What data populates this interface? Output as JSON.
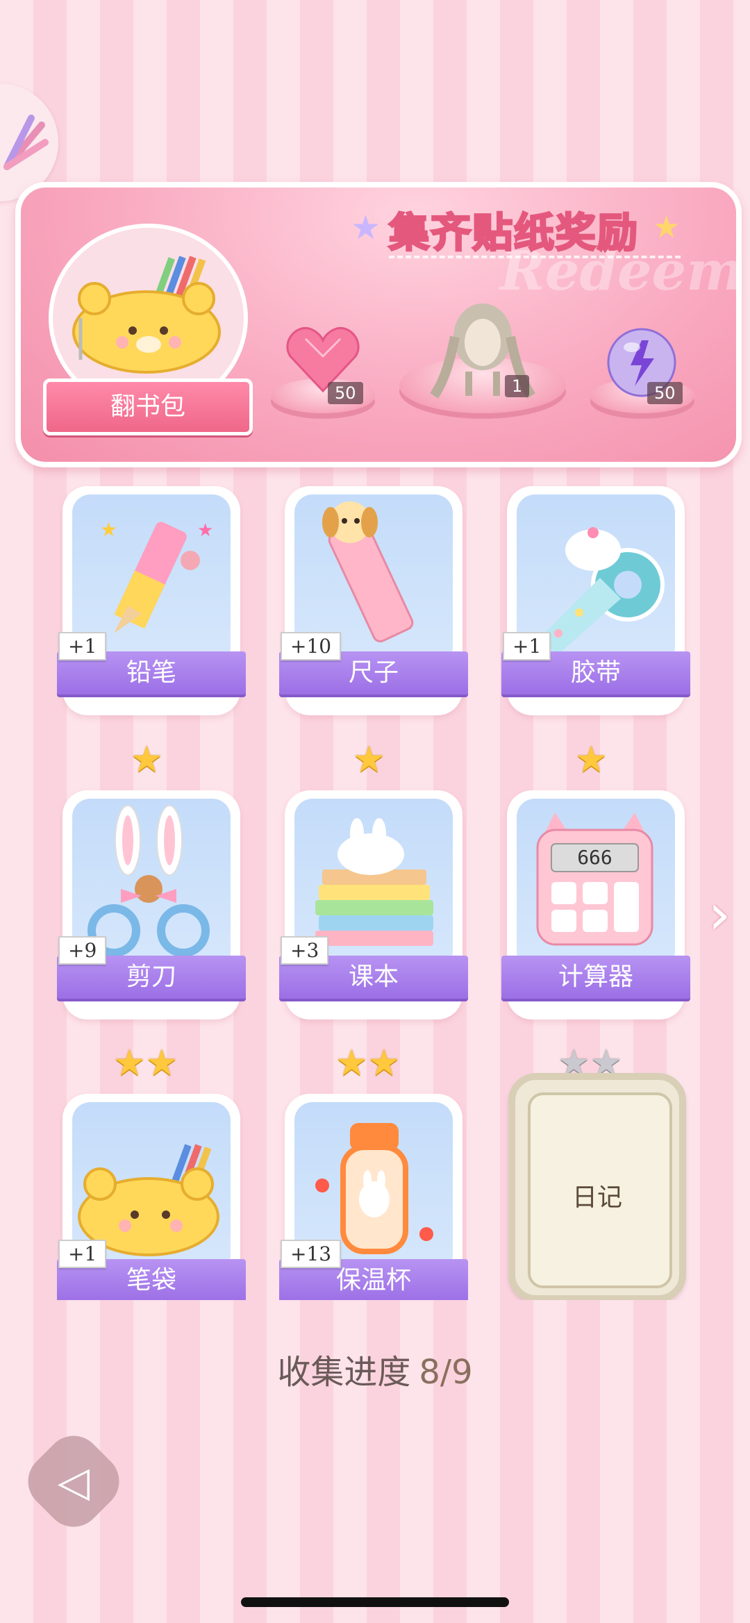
{
  "banner": {
    "title": "集齐贴纸奖励",
    "watermark": "Redeem",
    "featured_label": "翻书包",
    "rewards": [
      {
        "icon": "pink-heart-gem-icon",
        "count": "50"
      },
      {
        "icon": "braided-hair-avatar-icon",
        "count": "1"
      },
      {
        "icon": "purple-lightning-orb-icon",
        "count": "50"
      }
    ]
  },
  "stickers": [
    {
      "name": "铅笔",
      "count": "+1",
      "stars": 0,
      "icon": "pencil-icon"
    },
    {
      "name": "尺子",
      "count": "+10",
      "stars": 0,
      "icon": "ruler-icon"
    },
    {
      "name": "胶带",
      "count": "+1",
      "stars": 0,
      "icon": "tape-icon"
    },
    {
      "name": "剪刀",
      "count": "+9",
      "stars": 1,
      "icon": "scissors-icon"
    },
    {
      "name": "课本",
      "count": "+3",
      "stars": 1,
      "icon": "textbook-icon"
    },
    {
      "name": "计算器",
      "count": "",
      "stars": 1,
      "icon": "calculator-icon",
      "display": "666"
    },
    {
      "name": "笔袋",
      "count": "+1",
      "stars": 2,
      "icon": "pencil-case-icon"
    },
    {
      "name": "保温杯",
      "count": "+13",
      "stars": 2,
      "icon": "thermos-icon"
    },
    {
      "name": "日记",
      "count": "",
      "stars": 2,
      "icon": "diary-icon",
      "locked": true
    }
  ],
  "progress": {
    "label": "收集进度",
    "value": "8/9"
  },
  "colors": {
    "accent_pink": "#ef6789",
    "label_purple": "#9c6fe6",
    "star_gold": "#ffc83d"
  }
}
